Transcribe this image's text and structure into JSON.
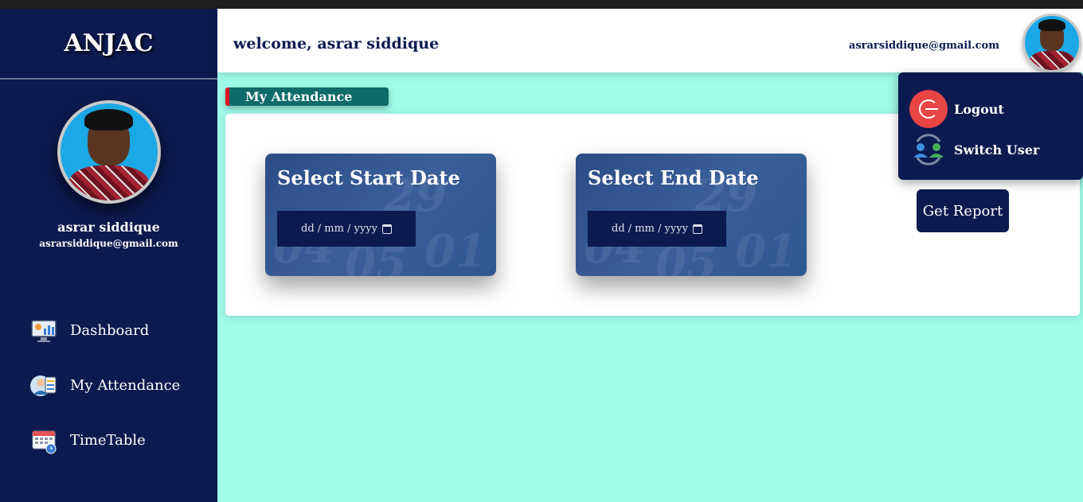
{
  "sidebar": {
    "brand": "ANJAC",
    "profile": {
      "name": "asrar siddique",
      "email": "asrarsiddique@gmail.com"
    },
    "nav": [
      {
        "label": "Dashboard",
        "icon": "dashboard-monitor-icon"
      },
      {
        "label": "My Attendance",
        "icon": "attendance-user-icon"
      },
      {
        "label": "TimeTable",
        "icon": "calendar-clock-icon"
      }
    ]
  },
  "header": {
    "welcome": "welcome, asrar siddique",
    "email": "asrarsiddique@gmail.com"
  },
  "section_tag": "My Attendance",
  "cards": {
    "start": {
      "title": "Select Start Date",
      "placeholder": "dd / mm / yyyy"
    },
    "end": {
      "title": "Select End Date",
      "placeholder": "dd / mm / yyyy"
    }
  },
  "actions": {
    "get_report": "Get Report"
  },
  "dropdown": {
    "logout": "Logout",
    "switch_user": "Switch User"
  },
  "colors": {
    "sidebar_bg": "#0b1a4f",
    "page_bg": "#9ffbea",
    "tag_bg": "#0f6a6a",
    "tag_accent": "#e0161f",
    "logout_red": "#e84545"
  }
}
